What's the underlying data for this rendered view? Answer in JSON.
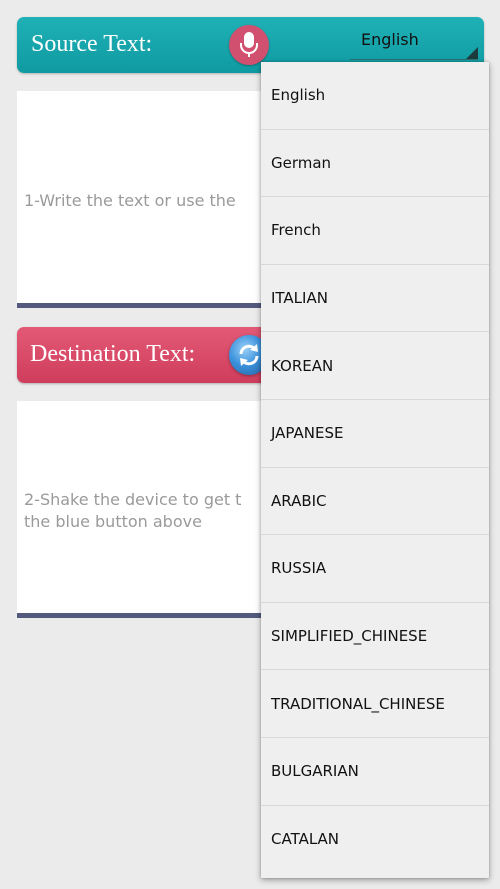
{
  "source": {
    "title": "Source Text:",
    "mic_icon": "microphone-icon",
    "selected_language": "English",
    "hint": "1-Write the text or use the"
  },
  "destination": {
    "title": "Destination Text:",
    "refresh_icon": "refresh-icon",
    "hint_lines": [
      "2-Shake the device to get t",
      "the blue button above"
    ]
  },
  "dropdown": {
    "items": [
      "English",
      "German",
      "French",
      "ITALIAN",
      "KOREAN",
      "JAPANESE",
      "ARABIC",
      "RUSSIA",
      "SIMPLIFIED_CHINESE",
      "TRADITIONAL_CHINESE",
      "BULGARIAN",
      "CATALAN"
    ]
  },
  "colors": {
    "source_header": "#17a7ad",
    "destination_header": "#d84866",
    "mic_button": "#d2506f",
    "text_box_underline": "#535a7d"
  }
}
